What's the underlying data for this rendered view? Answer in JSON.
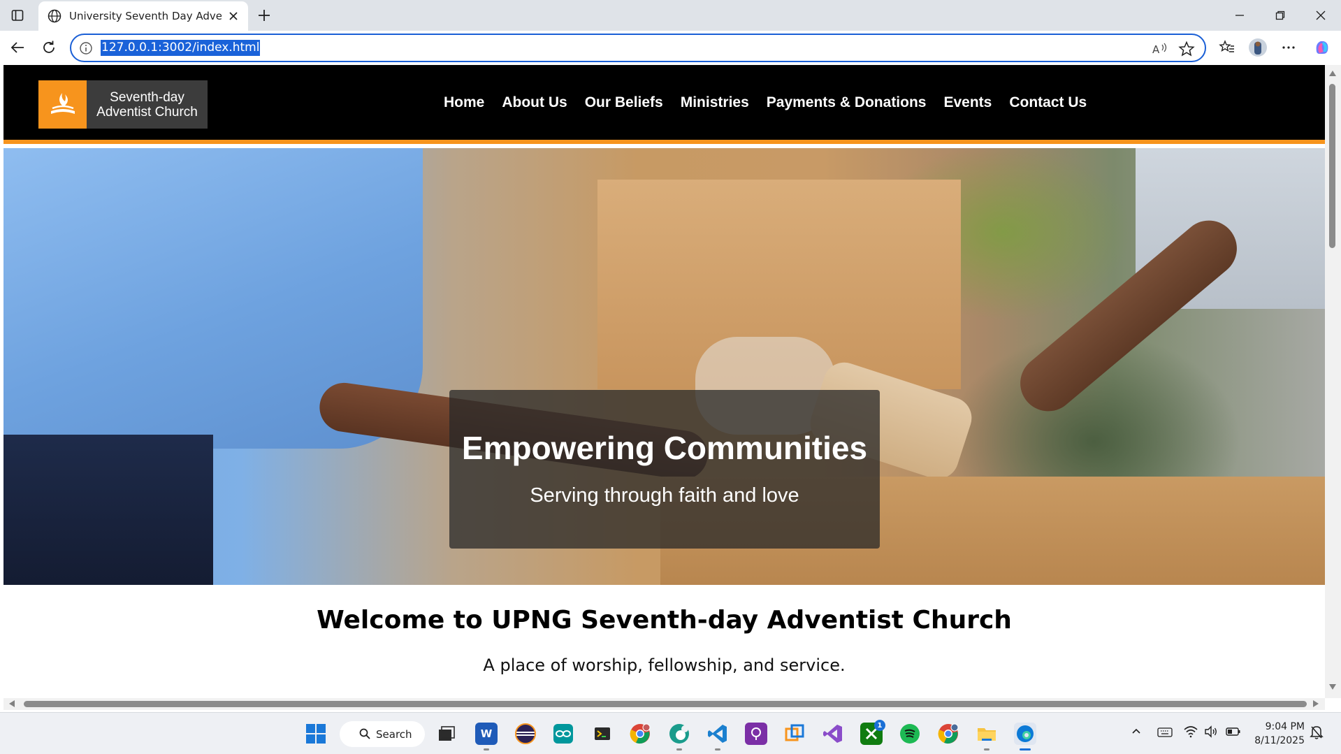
{
  "browser": {
    "tab_title": "University Seventh Day Adventist",
    "url": "127.0.0.1:3002/index.html"
  },
  "site": {
    "logo_line1": "Seventh-day",
    "logo_line2": "Adventist Church",
    "menu": [
      "Home",
      "About Us",
      "Our Beliefs",
      "Ministries",
      "Payments & Donations",
      "Events",
      "Contact Us"
    ],
    "hero_title": "Empowering Communities",
    "hero_subtitle": "Serving through faith and love",
    "welcome_title": "Welcome to UPNG Seventh-day Adventist Church",
    "welcome_text": "A place of worship, fellowship, and service."
  },
  "taskbar": {
    "search_label": "Search",
    "time": "9:04 PM",
    "date": "8/11/2025",
    "xbox_badge": "1"
  },
  "colors": {
    "accent_orange": "#f7941d",
    "header_black": "#000000",
    "address_highlight": "#1a62d9"
  }
}
